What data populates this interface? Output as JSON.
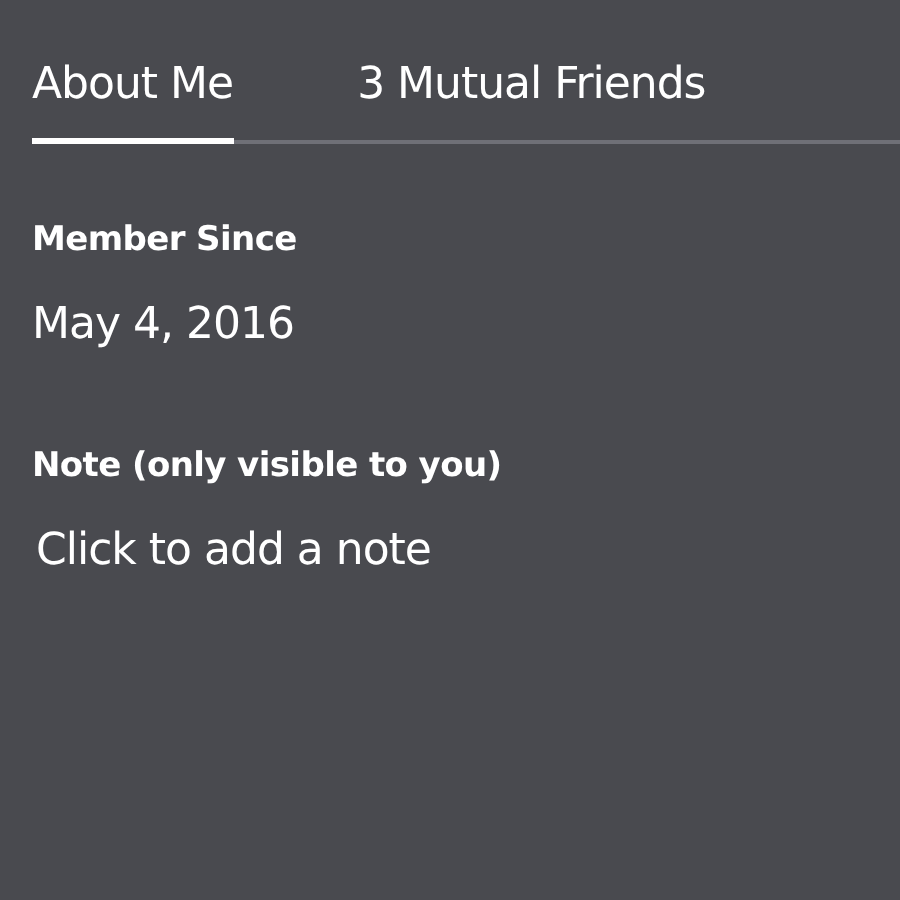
{
  "tabs": [
    {
      "label": "About Me",
      "selected": true
    },
    {
      "label": "3 Mutual Friends",
      "selected": false
    }
  ],
  "sections": [
    {
      "kind": "text",
      "heading": "Member Since",
      "value": "May 4, 2016"
    },
    {
      "kind": "field",
      "heading": "Note (only visible to you)",
      "placeholder": "Click to add a note"
    }
  ]
}
